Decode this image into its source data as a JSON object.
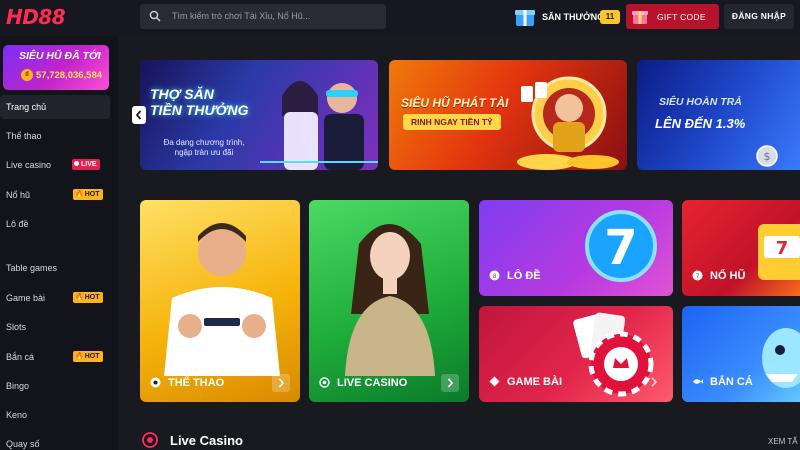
{
  "brand": {
    "logo_text": "HD88",
    "accent": "#ff2d55"
  },
  "header": {
    "search_placeholder": "Tìm kiếm trò chơi Tài Xỉu, Nổ Hũ...",
    "reward_label": "SĂN THƯỞNG",
    "reward_count": "11",
    "giftcode_label": "GIFT CODE",
    "login_label": "ĐĂNG NHẬP"
  },
  "sidebar": {
    "jackpot_title": "SIÊU HŨ ĐÃ TỚI",
    "jackpot_amount": "57,728,036,584",
    "items": [
      {
        "label": "Trang chủ",
        "active": true
      },
      {
        "label": "Thể thao"
      },
      {
        "label": "Live casino",
        "badge": "LIVE"
      },
      {
        "label": "Nổ hũ",
        "badge": "HOT"
      },
      {
        "label": "Lô đề"
      },
      {
        "label": "Table games"
      },
      {
        "label": "Game bài",
        "badge": "HOT"
      },
      {
        "label": "Slots"
      },
      {
        "label": "Bắn cá",
        "badge": "HOT"
      },
      {
        "label": "Bingo"
      },
      {
        "label": "Keno"
      },
      {
        "label": "Quay số"
      }
    ]
  },
  "banners": [
    {
      "title_line1": "THỢ SĂN",
      "title_line2": "TIỀN THƯỞNG",
      "subtitle_line1": "Đa dạng chương trình,",
      "subtitle_line2": "ngập tràn ưu đãi"
    },
    {
      "title": "SIÊU HŨ PHÁT TÀI",
      "pill": "RINH NGAY TIỀN TỶ"
    },
    {
      "title_line1": "SIÊU HOÀN TRẢ",
      "title_line2": "LÊN ĐẾN 1.3%"
    }
  ],
  "categories": {
    "sport": "THỂ THAO",
    "live_casino": "LIVE CASINO",
    "lode": "LÔ ĐỀ",
    "nohu": "NỔ HŨ",
    "gamebai": "GAME BÀI",
    "banca": "BẮN CÁ"
  },
  "live_section": {
    "title": "Live Casino",
    "see_all": "XEM TẤ"
  }
}
